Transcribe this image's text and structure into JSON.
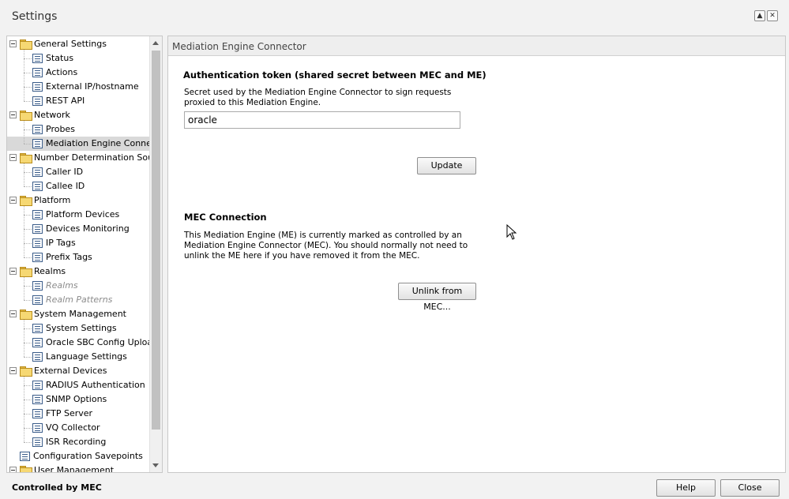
{
  "window": {
    "title": "Settings",
    "maximize_icon": "▲",
    "close_icon": "✕"
  },
  "tree": {
    "items": [
      {
        "label": "General Settings",
        "type": "folder",
        "level": 0
      },
      {
        "label": "Status",
        "type": "page",
        "level": 1
      },
      {
        "label": "Actions",
        "type": "page",
        "level": 1
      },
      {
        "label": "External IP/hostname",
        "type": "page",
        "level": 1
      },
      {
        "label": "REST API",
        "type": "page",
        "level": 1
      },
      {
        "label": "Network",
        "type": "folder",
        "level": 0
      },
      {
        "label": "Probes",
        "type": "page",
        "level": 1
      },
      {
        "label": "Mediation Engine Connector",
        "type": "page",
        "level": 1,
        "selected": true
      },
      {
        "label": "Number Determination Sources",
        "type": "folder",
        "level": 0
      },
      {
        "label": "Caller ID",
        "type": "page",
        "level": 1
      },
      {
        "label": "Callee ID",
        "type": "page",
        "level": 1
      },
      {
        "label": "Platform",
        "type": "folder",
        "level": 0
      },
      {
        "label": "Platform Devices",
        "type": "page",
        "level": 1
      },
      {
        "label": "Devices Monitoring",
        "type": "page",
        "level": 1
      },
      {
        "label": "IP Tags",
        "type": "page",
        "level": 1
      },
      {
        "label": "Prefix Tags",
        "type": "page",
        "level": 1
      },
      {
        "label": "Realms",
        "type": "folder",
        "level": 0
      },
      {
        "label": "Realms",
        "type": "page",
        "level": 1,
        "disabled": true
      },
      {
        "label": "Realm Patterns",
        "type": "page",
        "level": 1,
        "disabled": true
      },
      {
        "label": "System Management",
        "type": "folder",
        "level": 0
      },
      {
        "label": "System Settings",
        "type": "page",
        "level": 1
      },
      {
        "label": "Oracle SBC Config Upload",
        "type": "page",
        "level": 1
      },
      {
        "label": "Language Settings",
        "type": "page",
        "level": 1
      },
      {
        "label": "External Devices",
        "type": "folder",
        "level": 0
      },
      {
        "label": "RADIUS Authentication",
        "type": "page",
        "level": 1
      },
      {
        "label": "SNMP Options",
        "type": "page",
        "level": 1
      },
      {
        "label": "FTP Server",
        "type": "page",
        "level": 1
      },
      {
        "label": "VQ Collector",
        "type": "page",
        "level": 1
      },
      {
        "label": "ISR Recording",
        "type": "page",
        "level": 1
      },
      {
        "label": "Configuration Savepoints",
        "type": "root-page",
        "level": 0
      },
      {
        "label": "User Management",
        "type": "folder",
        "level": 0
      }
    ]
  },
  "content": {
    "header": "Mediation Engine Connector",
    "auth": {
      "title": "Authentication token (shared secret between MEC and ME)",
      "description": "Secret used by the Mediation Engine Connector to sign requests proxied to this Mediation Engine.",
      "token_value": "oracle",
      "update_label": "Update"
    },
    "mec": {
      "title": "MEC Connection",
      "description": "This Mediation Engine (ME) is currently marked as controlled by an Mediation Engine Connector (MEC). You should normally not need to unlink the ME here if you have removed it from the MEC.",
      "unlink_label": "Unlink from MEC..."
    }
  },
  "footer": {
    "status": "Controlled by MEC",
    "help_label": "Help",
    "close_label": "Close"
  }
}
